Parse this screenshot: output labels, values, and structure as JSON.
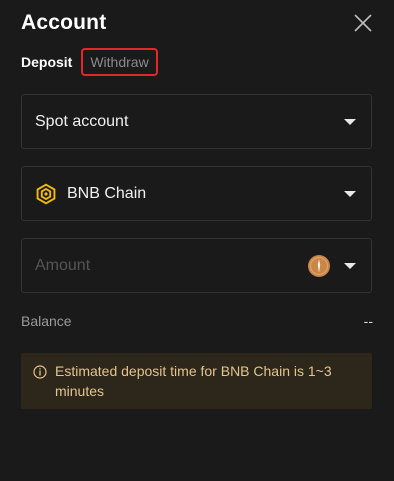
{
  "panel": {
    "title": "Account",
    "close_icon": "close-icon"
  },
  "tabs": [
    {
      "label": "Deposit",
      "active": true
    },
    {
      "label": "Withdraw",
      "active": false,
      "highlighted": true
    }
  ],
  "account_select": {
    "value": "Spot account",
    "icon": "caret-down-icon"
  },
  "network_select": {
    "value": "BNB Chain",
    "icon": "bnb-chain-icon"
  },
  "amount_field": {
    "placeholder": "Amount",
    "value": "",
    "coin_icon": "coin-icon"
  },
  "balance": {
    "label": "Balance",
    "value": "--"
  },
  "notice": {
    "icon": "info-icon",
    "text": "Estimated deposit time for BNB Chain is 1~3 minutes"
  },
  "colors": {
    "background": "#1a1a1a",
    "highlight_border": "#e02a2a",
    "notice_bg": "#2c261b",
    "notice_text": "#e3c58d",
    "bnb_yellow": "#f0b90b",
    "coin_brown": "#c9854a"
  }
}
